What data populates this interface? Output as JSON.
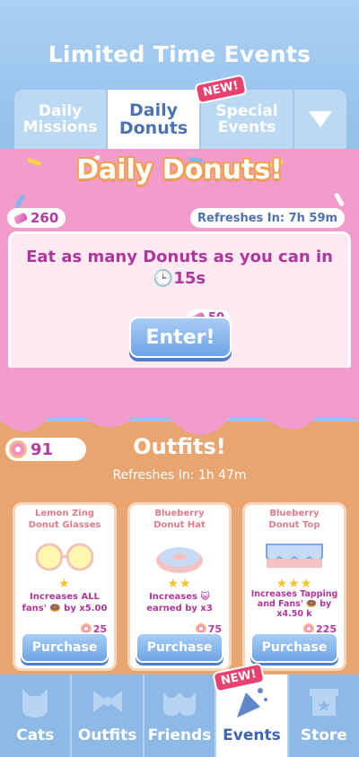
{
  "header": {
    "title": "Limited Time Events"
  },
  "tabs": [
    {
      "label": "Daily\nMissions",
      "active": false
    },
    {
      "label": "Daily\nDonuts",
      "active": true
    },
    {
      "label": "Special\nEvents",
      "active": false,
      "badge": "NEW!"
    }
  ],
  "tab_more_icon": "triangle-down-icon",
  "event": {
    "title": "Daily Donuts!",
    "gems": "260",
    "refresh": "Refreshes In: 7h 59m",
    "description": "Eat as many Donuts as you can in",
    "time": "15s",
    "enter_cost": "50",
    "enter_label": "Enter!"
  },
  "outfits": {
    "title": "Outfits!",
    "donuts": "91",
    "refresh": "Refreshes In: 1h 47m",
    "items": [
      {
        "name": "Lemon Zing\nDonut Glasses",
        "stars": "★",
        "desc": "Increases ALL\nfans' 🍩 by x5.00",
        "cost": "25",
        "button": "Purchase"
      },
      {
        "name": "Blueberry\nDonut Hat",
        "stars": "★★",
        "desc": "Increases 😺\nearned by x3",
        "cost": "75",
        "button": "Purchase"
      },
      {
        "name": "Blueberry\nDonut Top",
        "stars": "★★★",
        "desc": "Increases Tapping\nand Fans' 🍩 by\nx4.50 k",
        "cost": "225",
        "button": "Purchase"
      }
    ]
  },
  "nav": {
    "items": [
      {
        "label": "Cats",
        "icon": "cat-face-icon"
      },
      {
        "label": "Outfits",
        "icon": "bow-icon"
      },
      {
        "label": "Friends",
        "icon": "cats-group-icon"
      },
      {
        "label": "Events",
        "icon": "party-popper-icon",
        "badge": "NEW!",
        "active": true
      },
      {
        "label": "Store",
        "icon": "shop-icon"
      }
    ]
  },
  "colors": {
    "accent_blue": "#6fa3e6",
    "pink": "#f29ccc",
    "magenta_text": "#b0359c",
    "orange": "#e9a56f",
    "badge": "#e8416f"
  }
}
